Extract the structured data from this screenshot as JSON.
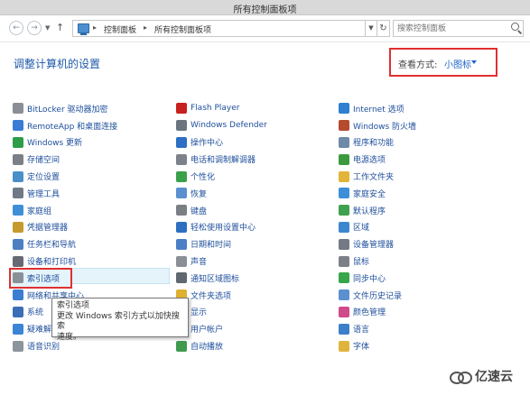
{
  "window": {
    "title": "所有控制面板项"
  },
  "address": {
    "segments": [
      "控制面板",
      "所有控制面板项"
    ],
    "search_placeholder": "搜索控制面板"
  },
  "header": {
    "title": "调整计算机的设置",
    "view_by_label": "查看方式:",
    "view_by_value": "小图标"
  },
  "columns": [
    [
      {
        "label": "BitLocker 驱动器加密",
        "icon": "bitlocker-icon",
        "color": "#8a8f96"
      },
      {
        "label": "RemoteApp 和桌面连接",
        "icon": "remoteapp-icon",
        "color": "#3a7bd5"
      },
      {
        "label": "Windows 更新",
        "icon": "windows-update-icon",
        "color": "#2e9d4a"
      },
      {
        "label": "存储空间",
        "icon": "storage-spaces-icon",
        "color": "#7a7f88"
      },
      {
        "label": "定位设置",
        "icon": "location-icon",
        "color": "#4a90c8"
      },
      {
        "label": "管理工具",
        "icon": "admin-tools-icon",
        "color": "#6f7a86"
      },
      {
        "label": "家庭组",
        "icon": "homegroup-icon",
        "color": "#3f8fd6"
      },
      {
        "label": "凭据管理器",
        "icon": "credential-manager-icon",
        "color": "#c79a2e"
      },
      {
        "label": "任务栏和导航",
        "icon": "taskbar-icon",
        "color": "#4b7fc2"
      },
      {
        "label": "设备和打印机",
        "icon": "printer-icon",
        "color": "#666b73"
      },
      {
        "label": "索引选项",
        "icon": "indexing-options-icon",
        "color": "#8a9099"
      },
      {
        "label": "网络和共享中心",
        "icon": "network-icon",
        "color": "#3b7dd0"
      },
      {
        "label": "系统",
        "icon": "system-icon",
        "color": "#3a6fb5"
      },
      {
        "label": "疑难解答",
        "icon": "troubleshooting-icon",
        "color": "#3b84d6"
      },
      {
        "label": "语音识别",
        "icon": "microphone-icon",
        "color": "#8e949c"
      }
    ],
    [
      {
        "label": "Flash Player",
        "icon": "flash-icon",
        "color": "#c8201e"
      },
      {
        "label": "Windows Defender",
        "icon": "defender-icon",
        "color": "#6b7580"
      },
      {
        "label": "操作中心",
        "icon": "action-center-icon",
        "color": "#2c6fc4"
      },
      {
        "label": "电话和调制解调器",
        "icon": "phone-modem-icon",
        "color": "#7d828a"
      },
      {
        "label": "个性化",
        "icon": "personalization-icon",
        "color": "#3aa14b"
      },
      {
        "label": "恢复",
        "icon": "recovery-icon",
        "color": "#5a8fd0"
      },
      {
        "label": "键盘",
        "icon": "keyboard-icon",
        "color": "#7a7f86"
      },
      {
        "label": "轻松使用设置中心",
        "icon": "ease-of-access-icon",
        "color": "#2e6fc0"
      },
      {
        "label": "日期和时间",
        "icon": "clock-icon",
        "color": "#4a7fc5"
      },
      {
        "label": "声音",
        "icon": "sound-icon",
        "color": "#8a8f96"
      },
      {
        "label": "通知区域图标",
        "icon": "notification-icons-icon",
        "color": "#5f6770"
      },
      {
        "label": "文件夹选项",
        "icon": "folder-options-icon",
        "color": "#e0b030"
      },
      {
        "label": "显示",
        "icon": "display-icon",
        "color": "#3b75c0"
      },
      {
        "label": "用户帐户",
        "icon": "user-accounts-icon",
        "color": "#3c86d4"
      },
      {
        "label": "自动播放",
        "icon": "autoplay-icon",
        "color": "#3f9a4e"
      }
    ],
    [
      {
        "label": "Internet 选项",
        "icon": "internet-options-icon",
        "color": "#2f7fd3"
      },
      {
        "label": "Windows 防火墙",
        "icon": "firewall-icon",
        "color": "#b44a2e"
      },
      {
        "label": "程序和功能",
        "icon": "programs-icon",
        "color": "#6e8aa8"
      },
      {
        "label": "电源选项",
        "icon": "power-options-icon",
        "color": "#3c9a3e"
      },
      {
        "label": "工作文件夹",
        "icon": "work-folders-icon",
        "color": "#e2b43a"
      },
      {
        "label": "家庭安全",
        "icon": "family-safety-icon",
        "color": "#3b8fd8"
      },
      {
        "label": "默认程序",
        "icon": "default-programs-icon",
        "color": "#3fa14f"
      },
      {
        "label": "区域",
        "icon": "region-icon",
        "color": "#3a87cf"
      },
      {
        "label": "设备管理器",
        "icon": "device-manager-icon",
        "color": "#737a83"
      },
      {
        "label": "鼠标",
        "icon": "mouse-icon",
        "color": "#7b8088"
      },
      {
        "label": "同步中心",
        "icon": "sync-center-icon",
        "color": "#37a64a"
      },
      {
        "label": "文件历史记录",
        "icon": "file-history-icon",
        "color": "#5b8fd0"
      },
      {
        "label": "颜色管理",
        "icon": "color-management-icon",
        "color": "#d14b8a"
      },
      {
        "label": "语言",
        "icon": "language-icon",
        "color": "#3d7fc9"
      },
      {
        "label": "字体",
        "icon": "fonts-icon",
        "color": "#e0b43c"
      }
    ]
  ],
  "tooltip": {
    "title": "索引选项",
    "line1": "更改 Windows 索引方式以加快搜索",
    "line2": "速度。"
  },
  "watermark": {
    "text": "亿速云"
  }
}
